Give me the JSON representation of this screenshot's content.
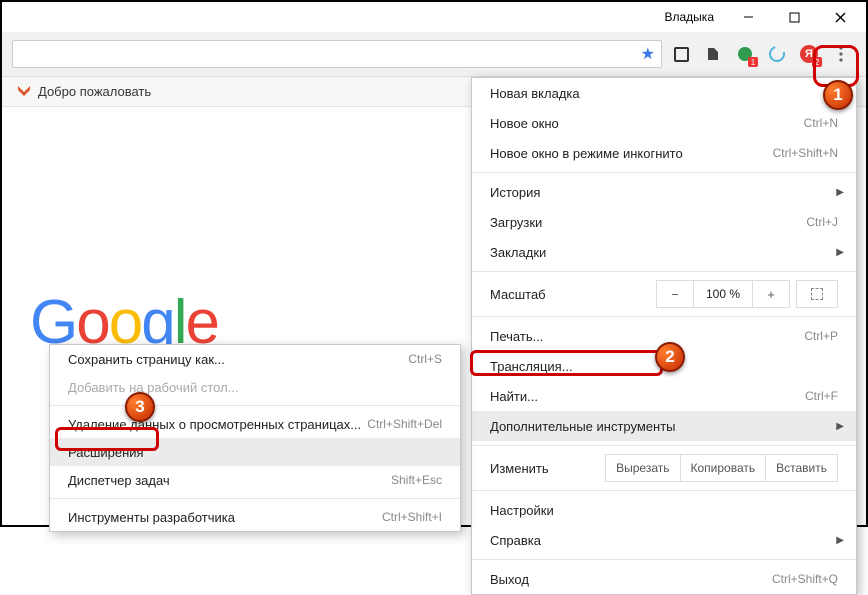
{
  "titlebar": {
    "user": "Владыка"
  },
  "bookmarks": {
    "welcome": "Добро пожаловать"
  },
  "menu": {
    "new_tab": "Новая вкладка",
    "new_window": "Новое окно",
    "new_window_sc": "Ctrl+N",
    "incognito": "Новое окно в режиме инкогнито",
    "incognito_sc": "Ctrl+Shift+N",
    "history": "История",
    "downloads": "Загрузки",
    "downloads_sc": "Ctrl+J",
    "bookmarks": "Закладки",
    "zoom_lbl": "Масштаб",
    "zoom_val": "100 %",
    "print": "Печать...",
    "print_sc": "Ctrl+P",
    "cast": "Трансляция...",
    "find": "Найти...",
    "find_sc": "Ctrl+F",
    "more_tools": "Дополнительные инструменты",
    "edit_lbl": "Изменить",
    "cut": "Вырезать",
    "copy": "Копировать",
    "paste": "Вставить",
    "settings": "Настройки",
    "help": "Справка",
    "exit": "Выход",
    "exit_sc": "Ctrl+Shift+Q"
  },
  "submenu": {
    "save_as": "Сохранить страницу как...",
    "save_as_sc": "Ctrl+S",
    "add_desktop": "Добавить на рабочий стол...",
    "clear_data": "Удаление данных о просмотренных страницах...",
    "clear_data_sc": "Ctrl+Shift+Del",
    "extensions": "Расширения",
    "taskmgr": "Диспетчер задач",
    "taskmgr_sc": "Shift+Esc",
    "devtools": "Инструменты разработчика",
    "devtools_sc": "Ctrl+Shift+I"
  },
  "callouts": {
    "n1": "1",
    "n2": "2",
    "n3": "3"
  },
  "ext_badges": {
    "one": "1",
    "two": "2"
  }
}
